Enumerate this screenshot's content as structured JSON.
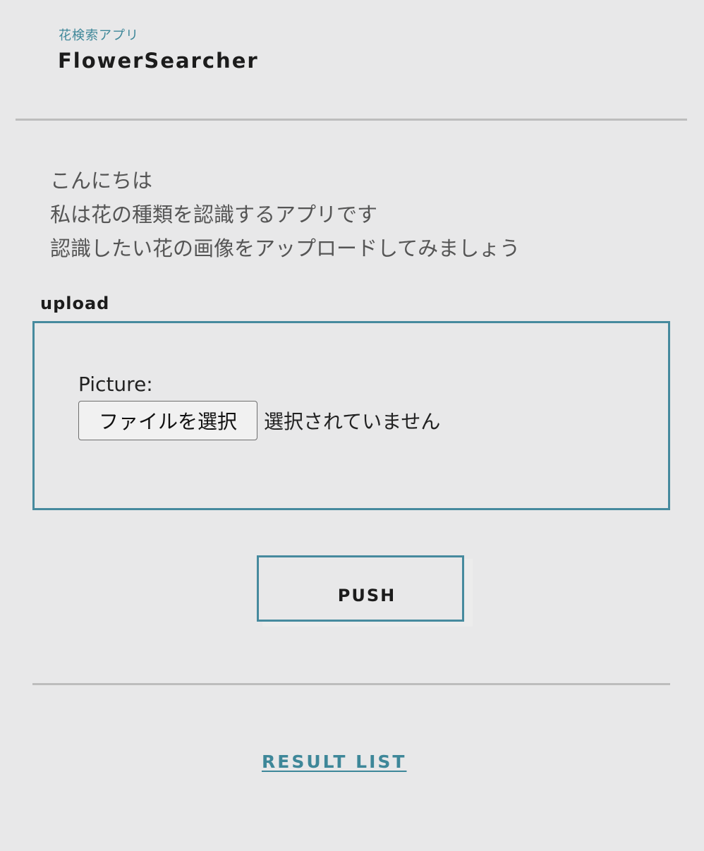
{
  "header": {
    "subtitle": "花検索アプリ",
    "logo": "FlowerSearcher"
  },
  "intro": {
    "lines": [
      "こんにちは",
      "私は花の種類を認識するアプリです",
      "認識したい花の画像をアップロードしてみましょう"
    ]
  },
  "upload": {
    "heading": "upload",
    "picture_label": "Picture:",
    "file_button_label": "ファイルを選択",
    "file_status": "選択されていません"
  },
  "actions": {
    "push_label": "PUSH",
    "result_link": "RESULT LIST"
  },
  "colors": {
    "accent": "#468a9e",
    "link": "#3e8799",
    "background": "#e8e8e9"
  }
}
